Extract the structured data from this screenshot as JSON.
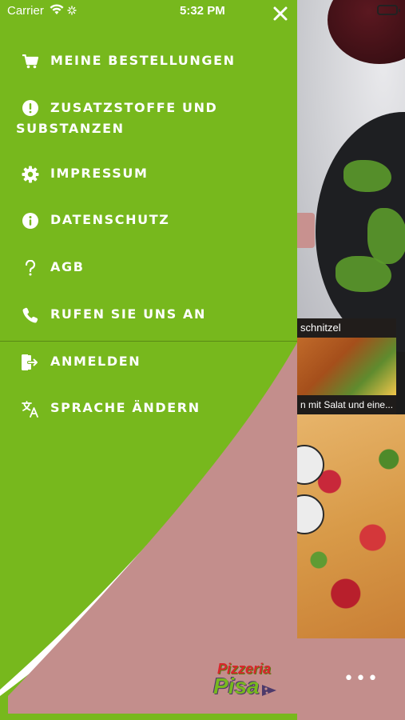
{
  "status_bar": {
    "carrier": "Carrier",
    "time": "5:32 PM"
  },
  "drawer": {
    "background_color": "#77b81d",
    "curve_color": "#c38e8c",
    "menu": [
      {
        "label": "MEINE BESTELLUNGEN",
        "icon": "cart-icon"
      },
      {
        "label": "ZUSATZSTOFFE UND SUBSTANZEN",
        "icon": "exclamation-circle-icon"
      },
      {
        "label": "IMPRESSUM",
        "icon": "gear-icon"
      },
      {
        "label": "DATENSCHUTZ",
        "icon": "info-circle-icon"
      },
      {
        "label": "AGB",
        "icon": "question-icon"
      },
      {
        "label": "RUFEN SIE UNS AN",
        "icon": "phone-icon"
      },
      {
        "label": "ANMELDEN",
        "icon": "login-icon"
      },
      {
        "label": "SPRACHE ÄNDERN",
        "icon": "translate-icon"
      }
    ],
    "logo": {
      "line1": "Pizzeria",
      "line2": "Pisa"
    }
  },
  "background": {
    "card_title": "schnitzel",
    "card_description": "n mit Salat und eine...",
    "more_label": "•••"
  }
}
